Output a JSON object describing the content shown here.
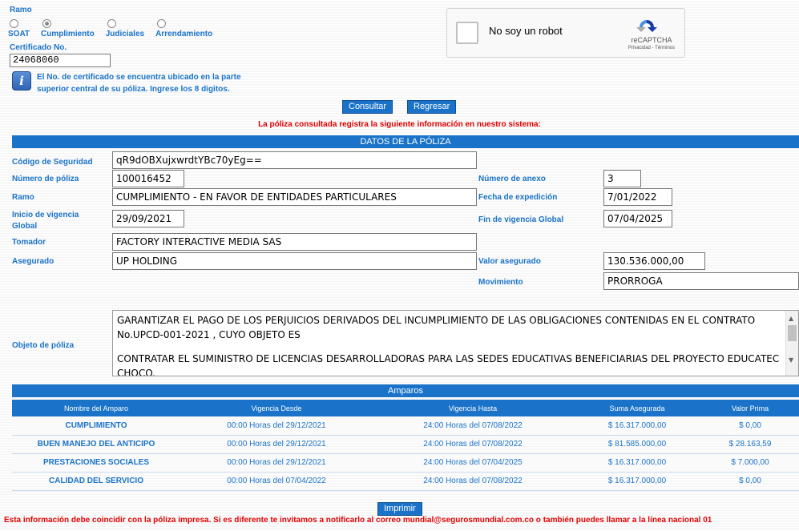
{
  "colors": {
    "accent": "#1a73c9",
    "alert": "#e00000"
  },
  "search": {
    "ramo_label": "Ramo",
    "options": [
      {
        "label": "SOAT",
        "checked": false
      },
      {
        "label": "Cumplimiento",
        "checked": true
      },
      {
        "label": "Judiciales",
        "checked": false
      },
      {
        "label": "Arrendamiento",
        "checked": false
      }
    ],
    "certificado_label": "Certificado No.",
    "certificado_value": "24068060",
    "info_icon": "info-icon",
    "info_text_1": "El No. de certificado se encuentra ubicado en la parte",
    "info_text_2": "superior central de su póliza. Ingrese los 8 digitos.",
    "consultar_label": "Consultar",
    "regresar_label": "Regresar"
  },
  "captcha": {
    "label": "No soy un robot",
    "brand": "reCAPTCHA",
    "terms": "Privacidad - Términos"
  },
  "result_message": "La póliza consultada registra la siguiente información en nuestro sistema:",
  "datos": {
    "title": "DATOS DE LA PÓLIZA",
    "codigo_label": "Código de Seguridad",
    "codigo_value": "qR9dOBXujxwrdtYBc70yEg==",
    "numero_label": "Número de póliza",
    "numero_value": "100016452",
    "anexo_label": "Número de anexo",
    "anexo_value": "3",
    "ramo_label": "Ramo",
    "ramo_value": "CUMPLIMIENTO - EN FAVOR DE ENTIDADES PARTICULARES",
    "expedicion_label": "Fecha de expedición",
    "expedicion_value": "7/01/2022",
    "inicio_label_1": "Inicio de vigencia",
    "inicio_label_2": "Global",
    "inicio_value": "29/09/2021",
    "fin_label": "Fin de vigencia Global",
    "fin_value": "07/04/2025",
    "tomador_label": "Tomador",
    "tomador_value": "FACTORY INTERACTIVE MEDIA SAS",
    "asegurado_label": "Asegurado",
    "asegurado_value": "UP HOLDING",
    "valor_label": "Valor asegurado",
    "valor_value": "130.536.000,00",
    "movimiento_label": "Movimiento",
    "movimiento_value": "PRORROGA",
    "objeto_label": "Objeto de póliza",
    "objeto_p1": "GARANTIZAR EL PAGO DE LOS PERJUICIOS DERIVADOS DEL INCUMPLIMIENTO DE LAS OBLIGACIONES CONTENIDAS EN EL CONTRATO No.UPCD-001-2021 , CUYO OBJETO ES",
    "objeto_p2": "CONTRATAR EL SUMINISTRO DE LICENCIAS DESARROLLADORAS PARA LAS SEDES EDUCATIVAS BENEFICIARIAS DEL PROYECTO EDUCATEC CHOCO."
  },
  "amparos": {
    "title": "Amparos",
    "headers": [
      "Nombre del Amparo",
      "Vigencia Desde",
      "Vigencia Hasta",
      "Suma Asegurada",
      "Valor Prima"
    ],
    "rows": [
      [
        "CUMPLIMIENTO",
        "00:00 Horas del 29/12/2021",
        "24:00 Horas del 07/08/2022",
        "$ 16.317.000,00",
        "$ 0,00"
      ],
      [
        "BUEN MANEJO DEL ANTICIPO",
        "00:00 Horas del 29/12/2021",
        "24:00 Horas del 07/08/2022",
        "$ 81.585.000,00",
        "$ 28.163,59"
      ],
      [
        "PRESTACIONES SOCIALES",
        "00:00 Horas del 29/12/2021",
        "24:00 Horas del 07/04/2025",
        "$ 16.317.000,00",
        "$ 7.000,00"
      ],
      [
        "CALIDAD DEL SERVICIO",
        "00:00 Horas del 07/04/2022",
        "24:00 Horas del 07/08/2022",
        "$ 16.317.000,00",
        "$ 0,00"
      ]
    ]
  },
  "imprimir_label": "Imprimir",
  "footer_message": "Esta información debe coincidir con la póliza impresa. Si es diferente te invitamos a notificarlo al correo mundial@segurosmundial.com.co o también puedes llamar a la línea nacional 01"
}
